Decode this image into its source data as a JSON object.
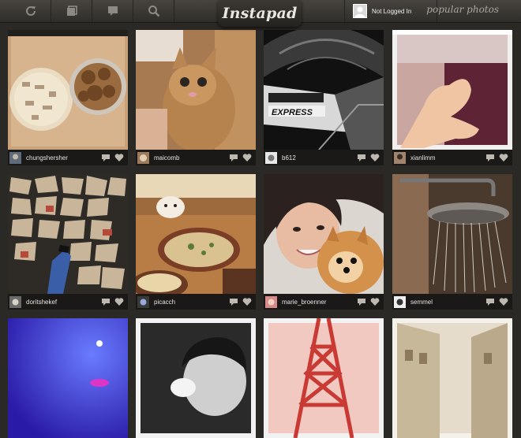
{
  "app": {
    "title": "Instapad",
    "user_status": "Not Logged In",
    "section_title": "popular photos"
  },
  "toolbar": [
    {
      "icon": "refresh-icon"
    },
    {
      "icon": "photos-icon"
    },
    {
      "icon": "comment-icon"
    },
    {
      "icon": "search-icon"
    }
  ],
  "photos": [
    {
      "username": "chungshersher",
      "subject": "cookies in tin"
    },
    {
      "username": "maicomb",
      "subject": "tabby cat"
    },
    {
      "username": "b612",
      "subject": "express train"
    },
    {
      "username": "xianlimm",
      "subject": "hand heart"
    },
    {
      "username": "doritshekef",
      "subject": "mosaic floor"
    },
    {
      "username": "picacch",
      "subject": "dinner table"
    },
    {
      "username": "marie_broenner",
      "subject": "girl with dog"
    },
    {
      "username": "semmel",
      "subject": "shower head"
    },
    {
      "username": "",
      "subject": "blue sky"
    },
    {
      "username": "",
      "subject": "boy"
    },
    {
      "username": "",
      "subject": "red tower"
    },
    {
      "username": "",
      "subject": "buildings"
    }
  ],
  "colors": {
    "background": "#2b2925",
    "footer": "#1a1917",
    "logo_text": "#e9e6df"
  }
}
